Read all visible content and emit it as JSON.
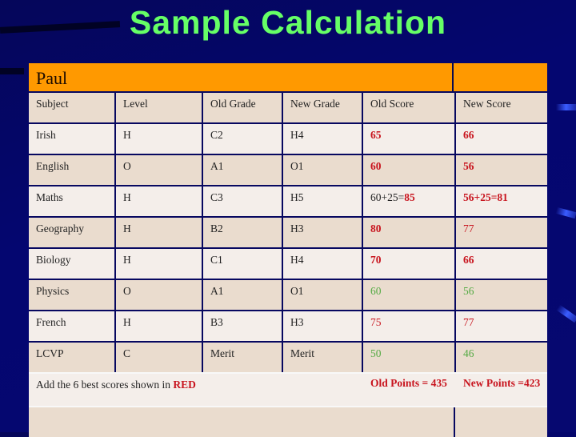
{
  "title": "Sample Calculation",
  "student": "Paul",
  "columns": [
    "Subject",
    "Level",
    "Old Grade",
    "New Grade",
    "Old Score",
    "New Score"
  ],
  "rows": [
    {
      "subject": "Irish",
      "level": "H",
      "old_grade": "C2",
      "new_grade": "H4",
      "old_score": {
        "prefix": "",
        "value": "65",
        "style": "red-bold"
      },
      "new_score": {
        "prefix": "",
        "value": "66",
        "style": "red-bold"
      }
    },
    {
      "subject": "English",
      "level": "O",
      "old_grade": "A1",
      "new_grade": "O1",
      "old_score": {
        "prefix": "",
        "value": "60",
        "style": "red-bold"
      },
      "new_score": {
        "prefix": "",
        "value": "56",
        "style": "red-bold"
      }
    },
    {
      "subject": "Maths",
      "level": "H",
      "old_grade": "C3",
      "new_grade": "H5",
      "old_score": {
        "prefix": "60+25=",
        "value": "85",
        "style": "red-bold"
      },
      "new_score": {
        "prefix": "",
        "value": "56+25=81",
        "style": "red-bold"
      }
    },
    {
      "subject": "Geography",
      "level": "H",
      "old_grade": "B2",
      "new_grade": "H3",
      "old_score": {
        "prefix": "",
        "value": "80",
        "style": "red-bold"
      },
      "new_score": {
        "prefix": "",
        "value": "77",
        "style": "red"
      }
    },
    {
      "subject": "Biology",
      "level": "H",
      "old_grade": "C1",
      "new_grade": "H4",
      "old_score": {
        "prefix": "",
        "value": "70",
        "style": "red-bold"
      },
      "new_score": {
        "prefix": "",
        "value": "66",
        "style": "red-bold"
      }
    },
    {
      "subject": "Physics",
      "level": "O",
      "old_grade": "A1",
      "new_grade": "O1",
      "old_score": {
        "prefix": "",
        "value": "60",
        "style": "green"
      },
      "new_score": {
        "prefix": "",
        "value": "56",
        "style": "green"
      }
    },
    {
      "subject": "French",
      "level": "H",
      "old_grade": "B3",
      "new_grade": "H3",
      "old_score": {
        "prefix": "",
        "value": "75",
        "style": "red"
      },
      "new_score": {
        "prefix": "",
        "value": "77",
        "style": "red"
      }
    },
    {
      "subject": "LCVP",
      "level": "C",
      "old_grade": "Merit",
      "new_grade": "Merit",
      "old_score": {
        "prefix": "",
        "value": "50",
        "style": "green"
      },
      "new_score": {
        "prefix": "",
        "value": "46",
        "style": "green"
      }
    }
  ],
  "footer": {
    "note": "Add the 6 best scores shown in ",
    "note_highlight": "RED",
    "old_points": "Old Points = 435",
    "new_points": "New Points =423"
  },
  "colors": {
    "title": "#66ff66",
    "header": "#ff9900",
    "red": "#c8141e",
    "green": "#55aa44",
    "background": "#04066a"
  }
}
